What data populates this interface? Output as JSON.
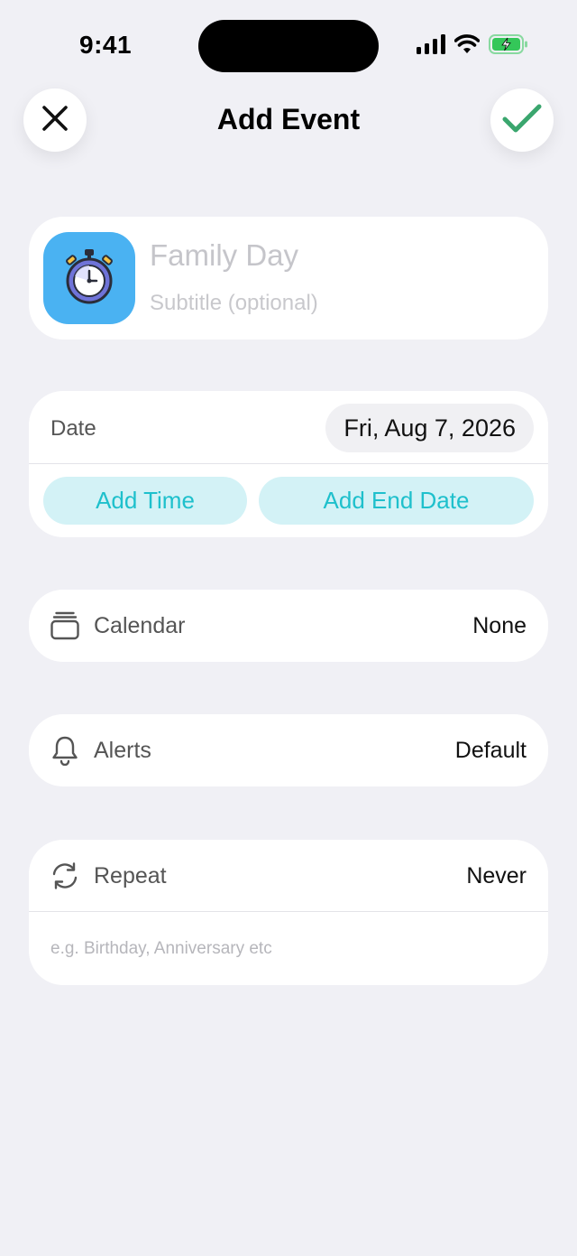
{
  "status_bar": {
    "time": "9:41"
  },
  "header": {
    "title": "Add Event",
    "close_icon": "close-icon",
    "done_icon": "checkmark-icon",
    "done_color": "#3aa66e"
  },
  "event": {
    "icon": "stopwatch-icon",
    "icon_bg": "#4ab2f2",
    "title_placeholder": "Family Day",
    "subtitle_placeholder": "Subtitle (optional)"
  },
  "date_section": {
    "label": "Date",
    "value": "Fri, Aug 7, 2026",
    "add_time_label": "Add Time",
    "add_end_date_label": "Add End Date",
    "accent_color": "#1ec0cc"
  },
  "calendar": {
    "icon": "calendar-stack-icon",
    "label": "Calendar",
    "value": "None"
  },
  "alerts": {
    "icon": "bell-icon",
    "label": "Alerts",
    "value": "Default"
  },
  "repeat": {
    "icon": "repeat-icon",
    "label": "Repeat",
    "value": "Never",
    "hint": "e.g. Birthday, Anniversary etc"
  }
}
